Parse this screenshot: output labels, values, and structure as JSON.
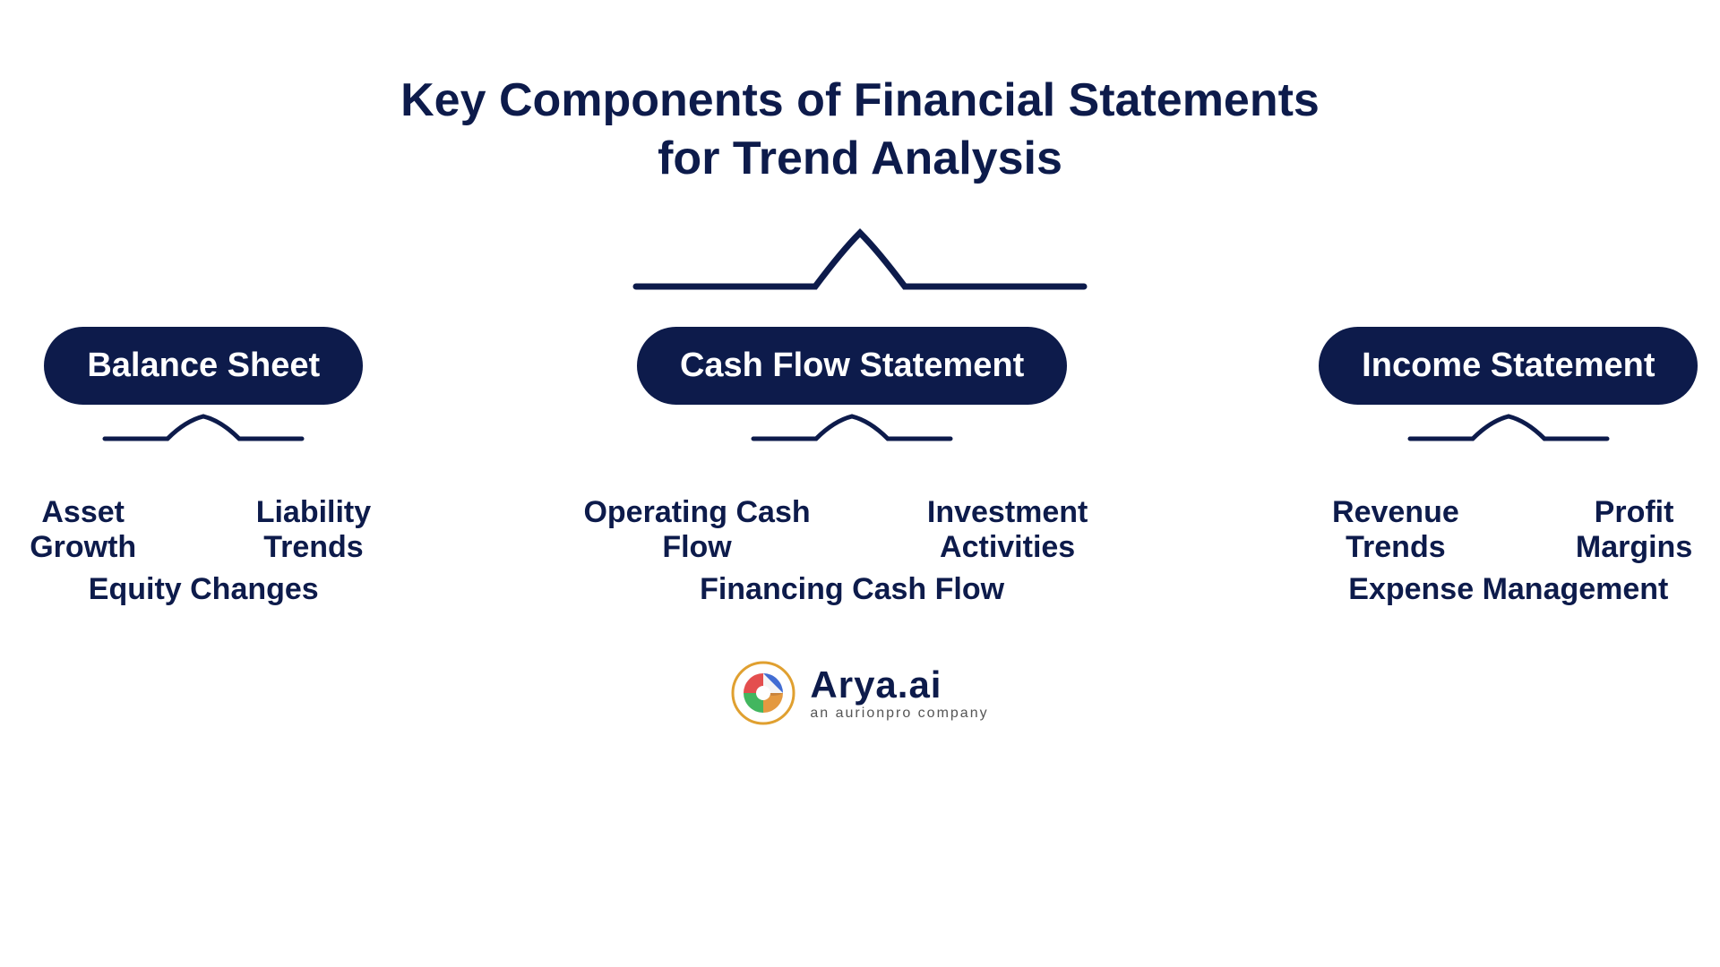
{
  "title": {
    "line1": "Key Components of Financial Statements",
    "line2": "for Trend Analysis"
  },
  "columns": [
    {
      "id": "balance-sheet",
      "label": "Balance Sheet",
      "sub_row1": [
        "Asset Growth",
        "Liability Trends"
      ],
      "sub_row2": [
        "Equity Changes"
      ]
    },
    {
      "id": "cash-flow",
      "label": "Cash Flow Statement",
      "sub_row1": [
        "Operating Cash Flow",
        "Investment Activities"
      ],
      "sub_row2": [
        "Financing Cash Flow"
      ]
    },
    {
      "id": "income-statement",
      "label": "Income Statement",
      "sub_row1": [
        "Revenue Trends",
        "Profit Margins"
      ],
      "sub_row2": [
        "Expense Management"
      ]
    }
  ],
  "logo": {
    "name": "Arya.ai",
    "tagline": "an aurionpro company"
  },
  "colors": {
    "dark_navy": "#0d1b4b",
    "white": "#ffffff"
  }
}
